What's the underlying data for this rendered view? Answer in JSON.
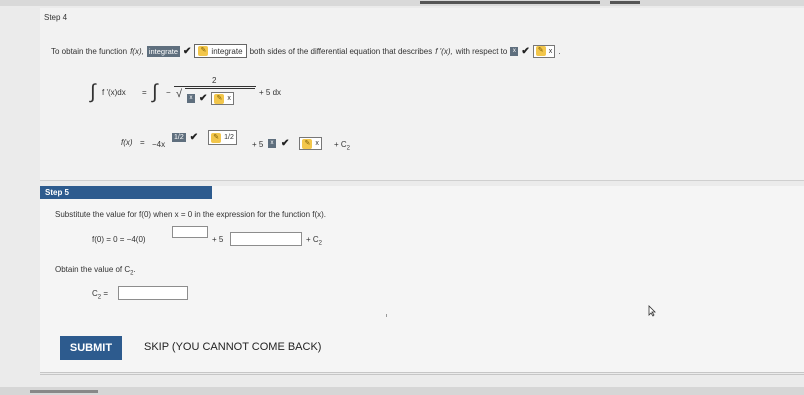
{
  "step4": {
    "title": "Step 4",
    "line1": {
      "prefix": "To obtain the function",
      "fx": "f(x),",
      "ans1": "integrate",
      "ans2": "integrate",
      "middle": "both sides of the differential equation that describes",
      "fpx": "f '(x),",
      "suffix": "with respect to",
      "var_dark": "x",
      "var_box": "x",
      "period": "."
    },
    "integral": {
      "lhs": "f '(x)dx",
      "eq": "=",
      "minus": "−",
      "numer": "2",
      "sqrt_dark": "x",
      "sqrt_box": "x",
      "tail": "+ 5 dx"
    },
    "result": {
      "lhs": "f(x)",
      "eq": "=",
      "coef": "−4x",
      "exp_dark": "1/2",
      "exp_box": "1/2",
      "plus5": "+ 5",
      "x_dark": "x",
      "x_box": "x",
      "plusC": "+ C",
      "c_sub": "2"
    }
  },
  "step5": {
    "title": "Step 5",
    "instruction": "Substitute the value for  f(0)  when  x = 0  in the expression for the function  f(x).",
    "equation": {
      "lhs": "f(0) = 0 = −4(0)",
      "plus5": "+ 5",
      "plusC": "+ C",
      "c_sub": "2"
    },
    "obtain": "Obtain the value of C",
    "obtain_sub": "2",
    "obtain_period": ".",
    "c2_label": "C",
    "c2_sub": "2",
    "c2_eq": "="
  },
  "buttons": {
    "submit": "SUBMIT",
    "skip": "SKIP (YOU CANNOT COME BACK)"
  },
  "colors": {
    "accent": "#2d5b8e",
    "dark_answer": "#5f6f7e",
    "pencil": "#f2c64b"
  },
  "icons": [
    "check-icon",
    "pencil-icon",
    "integral-icon",
    "cursor-icon"
  ]
}
